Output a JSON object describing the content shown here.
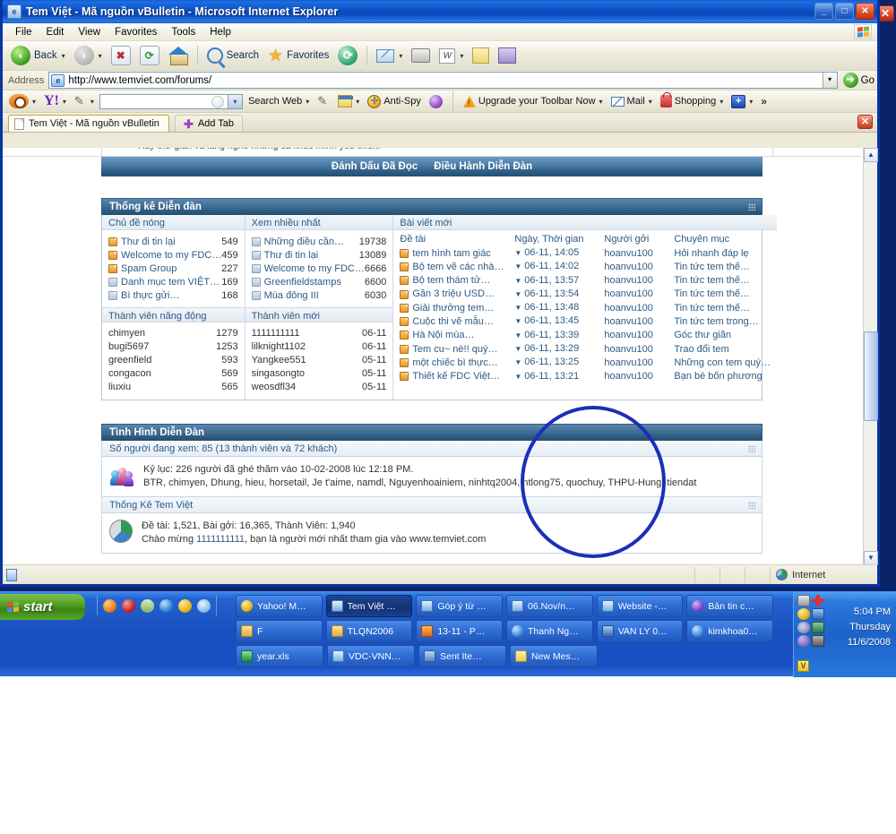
{
  "window": {
    "title": "Tem Việt - Mã nguồn vBulletin - Microsoft Internet Explorer",
    "minimize_label": "_",
    "maximize_label": "□",
    "close_label": "✕",
    "stray_close_label": "✕"
  },
  "menu": [
    {
      "label": "File"
    },
    {
      "label": "Edit"
    },
    {
      "label": "View"
    },
    {
      "label": "Favorites"
    },
    {
      "label": "Tools"
    },
    {
      "label": "Help"
    }
  ],
  "toolbar": {
    "back_label": "Back",
    "search_label": "Search",
    "favorites_label": "Favorites",
    "caret": "▾",
    "stop_label": "✖",
    "refresh_label": "⟳",
    "w_label": "W"
  },
  "address": {
    "label": "Address",
    "url": "http://www.temviet.com/forums/",
    "go_label": "Go",
    "go_arrow": "➔",
    "dropdown_caret": "▾"
  },
  "yahoo_toolbar": {
    "yahoo_logo": "Y!",
    "search_value": "",
    "search_web_label": "Search Web",
    "antispy_label": "Anti-Spy",
    "upgrade_label": "Upgrade your Toolbar Now",
    "mail_label": "Mail",
    "shopping_label": "Shopping",
    "plus_label": "+",
    "overflow_label": "»",
    "caret": "▾"
  },
  "tabs": {
    "items": [
      {
        "label": "Tem Việt - Mã nguồn vBulletin"
      }
    ],
    "add_tab_label": "Add Tab",
    "add_tab_icon": "✚",
    "close_label": "✕"
  },
  "page": {
    "cutoff_text": "Hãy thư giãn và lắng nghe những ca khúc mình yêu thích.",
    "nav_links": [
      {
        "label": "Đánh Dấu Đã Đọc"
      },
      {
        "label": "Điều Hành Diễn Đàn"
      }
    ],
    "stats_panel": {
      "title": "Thống kê Diễn đàn",
      "hot_topics": {
        "header": "Chủ đề nóng",
        "rows": [
          {
            "name": "Thư đi tin lại",
            "value": "549",
            "icon": "orange"
          },
          {
            "name": "Welcome to my FDC…",
            "value": "459",
            "icon": "orange"
          },
          {
            "name": "Spam Group",
            "value": "227",
            "icon": "orange"
          },
          {
            "name": "Danh mục tem VIỆT…",
            "value": "169",
            "icon": "gray"
          },
          {
            "name": "Bì thực gửi…",
            "value": "168",
            "icon": "gray"
          }
        ]
      },
      "most_viewed": {
        "header": "Xem nhiều nhất",
        "rows": [
          {
            "name": "Những điều cần…",
            "value": "19738",
            "icon": "gray"
          },
          {
            "name": "Thư đi tin lại",
            "value": "13089",
            "icon": "gray"
          },
          {
            "name": "Welcome to my FDC…",
            "value": "6666",
            "icon": "gray"
          },
          {
            "name": "Greenfieldstamps",
            "value": "6600",
            "icon": "gray"
          },
          {
            "name": "Mùa đông III",
            "value": "6030",
            "icon": "gray"
          }
        ]
      },
      "active_members": {
        "header": "Thành viên năng động",
        "rows": [
          {
            "name": "chimyen",
            "value": "1279"
          },
          {
            "name": "bugi5697",
            "value": "1253"
          },
          {
            "name": "greenfield",
            "value": "593"
          },
          {
            "name": "congacon",
            "value": "569"
          },
          {
            "name": "liuxiu",
            "value": "565"
          }
        ]
      },
      "new_members": {
        "header": "Thành viên mới",
        "rows": [
          {
            "name": "1111111111",
            "value": "06-11"
          },
          {
            "name": "lilknight1102",
            "value": "06-11"
          },
          {
            "name": "Yangkee551",
            "value": "05-11"
          },
          {
            "name": "singasongto",
            "value": "05-11"
          },
          {
            "name": "weosdfl34",
            "value": "05-11"
          }
        ]
      },
      "new_posts": {
        "header": "Bài viết mới",
        "columns": {
          "title": "Đề tài",
          "date": "Ngày, Thời gian",
          "user": "Người gởi",
          "category": "Chuyên mục"
        },
        "rows": [
          {
            "title": "tem hình tam giác",
            "date": "06-11, 14:05",
            "user": "hoanvu100",
            "category": "Hỏi nhanh đáp lẹ"
          },
          {
            "title": "Bộ tem vẽ các nhà…",
            "date": "06-11, 14:02",
            "user": "hoanvu100",
            "category": "Tin tức tem thế…"
          },
          {
            "title": "Bộ tem thám tử…",
            "date": "06-11, 13:57",
            "user": "hoanvu100",
            "category": "Tin tức tem thế…"
          },
          {
            "title": "Gần 3 triệu USD…",
            "date": "06-11, 13:54",
            "user": "hoanvu100",
            "category": "Tin tức tem thế…"
          },
          {
            "title": "Giải thưởng tem…",
            "date": "06-11, 13:48",
            "user": "hoanvu100",
            "category": "Tin tức tem thế…"
          },
          {
            "title": "Cuộc thi vẽ mẫu…",
            "date": "06-11, 13:45",
            "user": "hoanvu100",
            "category": "Tin tức tem trong…"
          },
          {
            "title": "Hà Nội mùa…",
            "date": "06-11, 13:39",
            "user": "hoanvu100",
            "category": "Góc thư giãn"
          },
          {
            "title": "Tem cu~ nè!! quý…",
            "date": "06-11, 13:29",
            "user": "hoanvu100",
            "category": "Trao đổi tem"
          },
          {
            "title": "một chiếc bì thực…",
            "date": "06-11, 13:25",
            "user": "hoanvu100",
            "category": "Những con tem quý…"
          },
          {
            "title": "Thiết kế FDC Việt…",
            "date": "06-11, 13:21",
            "user": "hoanvu100",
            "category": "Bạn bè bốn phương"
          }
        ]
      }
    },
    "status_panel": {
      "title": "Tình Hình Diễn Đàn",
      "viewing_label": "Số người đang xem: 85 (13 thành viên và 72 khách)",
      "record_line": "Kỷ lục: 226 người đã ghé thăm vào 10-02-2008 lúc 12:18 PM.",
      "members_line": "BTR, chimyen, Dhung, hieu, horsetail, Je t'aime, namdl, Nguyenhoainiem, ninhtq2004, ntlong75, quochuy, THPU-Hung, tiendat",
      "stats_title": "Thống Kê Tem Việt",
      "stats_line1": "Đề tài: 1,521, Bài gởi: 16,365, Thành Viên: 1,940",
      "stats_line2_prefix": "Chào mừng ",
      "stats_line2_user": "1111111111",
      "stats_line2_suffix": ", bạn là người mới nhất tham gia vào www.temviet.com"
    }
  },
  "statusbar": {
    "zone_label": "Internet"
  },
  "taskbar": {
    "start_label": "start",
    "tasks": [
      [
        {
          "label": "Yahoo! M…",
          "icon": "ti-ym",
          "active": false
        },
        {
          "label": "Tem Việt …",
          "icon": "ti-ie",
          "active": true
        },
        {
          "label": "Góp ý từ …",
          "icon": "ti-ie",
          "active": false
        },
        {
          "label": "06.Nov/n…",
          "icon": "ti-ie",
          "active": false
        },
        {
          "label": "Website -…",
          "icon": "ti-ie",
          "active": false
        },
        {
          "label": "Bản tin c…",
          "icon": "ti-blue",
          "active": false
        }
      ],
      [
        {
          "label": "F",
          "icon": "ti-folder",
          "active": false
        },
        {
          "label": "TLQN2006",
          "icon": "ti-folder",
          "active": false
        },
        {
          "label": "13-11 - P…",
          "icon": "ti-cam",
          "active": false
        },
        {
          "label": "Thanh Ng…",
          "icon": "ti-ym2",
          "active": false
        },
        {
          "label": "VAN LY 0…",
          "icon": "ti-doc",
          "active": false
        },
        {
          "label": "kimkhoa0…",
          "icon": "ti-ym2",
          "active": false
        }
      ],
      [
        {
          "label": "year.xls",
          "icon": "ti-xls",
          "active": false
        },
        {
          "label": "VDC-VNN…",
          "icon": "ti-ie",
          "active": false
        },
        {
          "label": "Sent Ite…",
          "icon": "ti-out",
          "active": false
        },
        {
          "label": "New Mes…",
          "icon": "ti-msg",
          "active": false
        }
      ]
    ],
    "tray": {
      "time": "5:04 PM",
      "day": "Thursday",
      "date": "11/6/2008",
      "vbadge": "V"
    }
  },
  "colors": {
    "titlebar_blue": "#0a46b8",
    "panel_header": "#2b587c",
    "link_blue": "#2b5a85",
    "annotation_circle": "#1b2fb8",
    "taskbar_blue": "#1a4fc0",
    "start_green": "#4e9c21"
  }
}
